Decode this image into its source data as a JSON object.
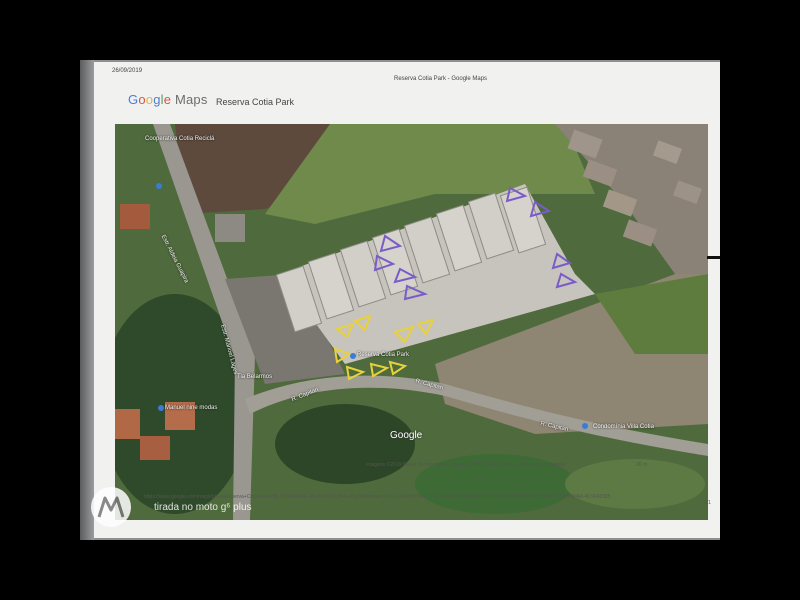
{
  "print_header": {
    "date": "26/09/2019",
    "title": "Reserva Cotia Park - Google Maps"
  },
  "brand": {
    "logo": "Google Maps",
    "place_name": "Reserva Cotia Park"
  },
  "map": {
    "labels": {
      "top_left": "Cooperativa Cotia Reciclá",
      "road_vertical_1": "Estr. Aldeia Guapira",
      "road_vertical_2": "Estr. Manoel Lages",
      "building_name": "Reserva Cotia Park",
      "shop_1": "Tia Belarmos",
      "shop_2": "Manuel nine modas",
      "road_1": "R. Capitari",
      "road_2": "R. Capitari",
      "road_3": "R. Capitari",
      "condo": "Condomínia Villa Cotia"
    },
    "watermark": "Google",
    "imagery_credit": "Imagens ©2019 Maxar Technologies, Imagens ©2019 CNES / Airbus, Maxar Technologies",
    "scale_text": "20 m",
    "marker_colors": {
      "purple": "#7a5cc8",
      "yellow": "#e8d23a"
    }
  },
  "footer": {
    "url": "https://www.google.com/maps/place/Reserva+Cotia+Park/@-23.5942542,-46.9045751,294a,35y,180h/data=!3m1!1e3!4m5!3m4!1s0x94cf074c08af2eb5:0x8828b356cf563153!8m2!3d-23.5936769!4d-46.9042385",
    "page": "1/1"
  },
  "camera_watermark": {
    "icon": "motorola-logo-icon",
    "text": "tirada no moto g⁶ plus"
  }
}
